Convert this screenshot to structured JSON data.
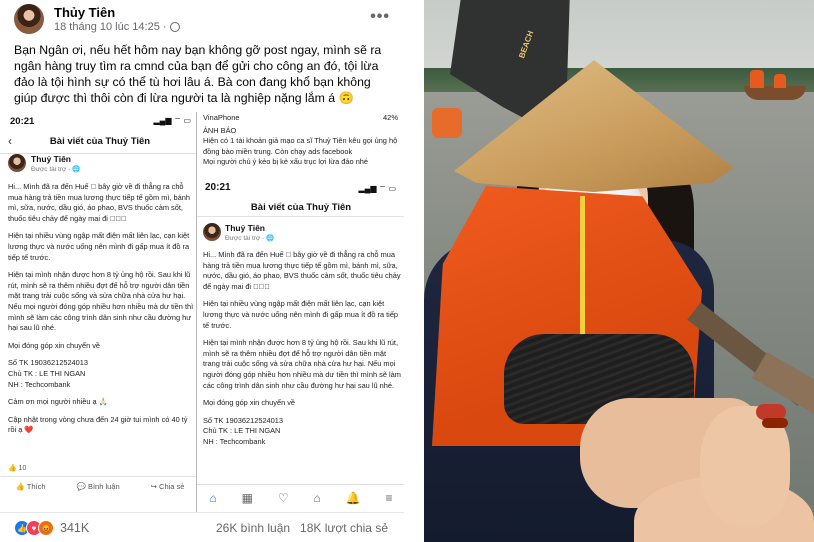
{
  "post": {
    "author": "Thủy Tiên",
    "timestamp": "18 tháng 10 lúc 14:25 ·",
    "more_label": "•••",
    "text": "Bạn Ngân ơi, nếu hết hôm nay bạn không gỡ post ngay, mình sẽ ra ngân hàng truy tìm ra cmnd của bạn để gửi cho công an đó, tội lừa đảo là tội hình sự có thể tù hơi lâu á. Bà con đang khổ bạn không giúp được thì thôi còn đi lừa người ta là nghiệp nặng lắm á 🙃",
    "reactions_count": "341K",
    "comments": "26K bình luận",
    "shares": "18K lượt chia sẻ"
  },
  "screenshot_a": {
    "time": "20:21",
    "signal": "▂▄▆ ⌔ ▭",
    "back": "‹",
    "title": "Bài viết của Thuỷ Tiên",
    "name": "Thuỷ Tiên",
    "sponsored": "Được tài trợ · 🌐",
    "paragraphs": [
      "Hi... Mình đã ra đến Huế 🏻 bây giờ về đi thẳng ra chỗ mua hàng trả tiền mua lương thực tiếp tế gồm mì, bánh mì, sữa, nước, dầu gió, áo phao, BVS thuốc cảm sốt, thuốc tiêu chảy để ngày mai đi 🏻🏻🏻",
      "Hiện tại nhiều vùng ngập mất điện mất liên lạc, cạn kiệt lương thực và nước uống nên mình đi gấp mua ít đồ ra tiếp tế trước.",
      "Hiện tại mình nhận được hơn 8 tỷ ủng hộ rồi. Sau khi lũ rút, mình sẽ ra thêm nhiều đợt để hỗ trợ người dân tiền mặt trang trải cuộc sống và sửa chữa nhà cửa hư hại. Nếu mọi người đóng góp nhiều hơn nhiều mà dư tiền thì mình sẽ làm các công trình dân sinh như cầu đường hư hại sau lũ nhé.",
      "Mọi đóng góp xin chuyển về",
      "Số TK 19036212524013\nChủ TK : LE THI NGAN\nNH : Techcombank",
      "Cảm ơn mọi người nhiều ạ 🙏🏻",
      "Cập nhật trong vòng chưa đến 24 giờ tui mình có 40 tỷ rồi ạ ❤️"
    ],
    "react": "👍 10",
    "actions": [
      "👍 Thích",
      "💬 Bình luận",
      "↪ Chia sẻ"
    ]
  },
  "screenshot_b": {
    "carrier": "VinaPhone",
    "battery": "42%",
    "warning": "ẢNH BÁO\nHiện có 1 tài khoản giả mạo ca sĩ Thuỷ Tiên kêu gọi ủng hộ đồng bào miền trung. Còn chạy ads facebook\nMọi người chú ý kẻo bị kẻ xấu trục lợi lừa đảo nhé",
    "time": "20:21",
    "icons": "▂▄▆ ⌔ ▭",
    "title": "Bài viết của Thuỷ Tiên",
    "name": "Thuỷ Tiên",
    "sponsored": "Được tài trợ · 🌐",
    "paragraphs": [
      "Hi... Mình đã ra đến Huế 🏻 bây giờ về đi thẳng ra chỗ mua hàng trả tiền mua lương thực tiếp tế gồm mì, bánh mì, sữa, nước, dầu gió, áo phao, BVS thuốc cảm sốt, thuốc tiêu chảy để ngày mai đi 🏻🏻🏻",
      "Hiện tại nhiều vùng ngập mất điện mất liên lạc, cạn kiệt lương thực và nước uống nên mình đi gấp mua ít đồ ra tiếp tế trước.",
      "Hiện tại mình nhận được hơn 8 tỷ ủng hộ rồi. Sau khi lũ rút, mình sẽ ra thêm nhiều đợt để hỗ trợ người dân tiền mặt trang trải cuộc sống và sửa chữa nhà cửa hư hại. Nếu mọi người đóng góp nhiều hơn nhiều mà dư tiền thì mình sẽ làm các công trình dân sinh như cầu đường hư hại sau lũ nhé.",
      "Mọi đóng góp xin chuyển về",
      "Số TK 19036212524013\nChủ TK : LE THI NGAN\nNH : Techcombank"
    ],
    "nav": [
      "⌂",
      "▦",
      "♡",
      "⌂",
      "🔔",
      "≡"
    ]
  },
  "photo": {
    "umbrella_text": "BEACH"
  }
}
